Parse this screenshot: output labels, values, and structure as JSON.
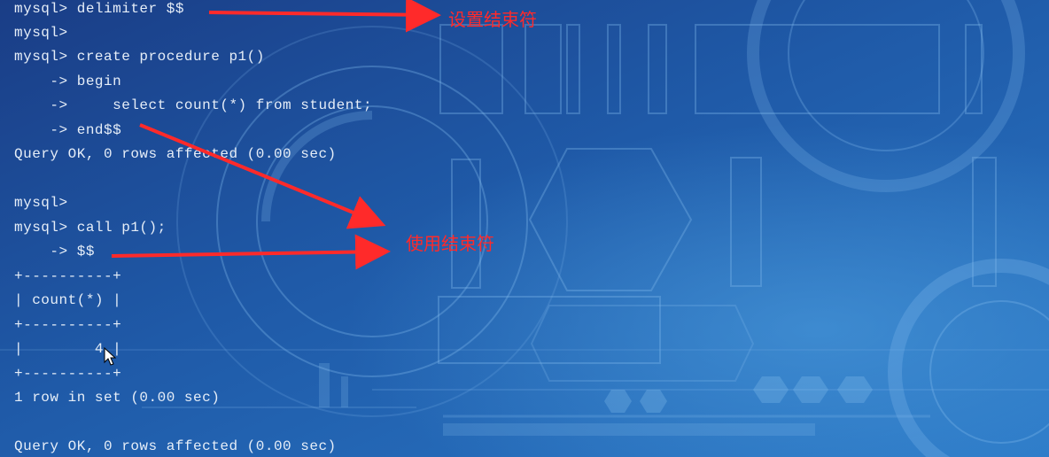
{
  "terminal": {
    "lines": [
      "mysql> delimiter $$",
      "mysql>",
      "mysql> create procedure p1()",
      "    -> begin",
      "    ->     select count(*) from student;",
      "    -> end$$",
      "Query OK, 0 rows affected (0.00 sec)",
      "",
      "mysql>",
      "mysql> call p1();",
      "    -> $$",
      "+----------+",
      "| count(*) |",
      "+----------+",
      "|        4 |",
      "+----------+",
      "1 row in set (0.00 sec)",
      "",
      "Query OK, 0 rows affected (0.00 sec)"
    ]
  },
  "annotations": {
    "set_delimiter": "设置结束符",
    "use_delimiter": "使用结束符"
  },
  "colors": {
    "background": "#1d4f96",
    "terminal_text": "#e6eef8",
    "annotation": "#ff2a2a"
  },
  "icons": {
    "cursor": "mouse-pointer-icon"
  }
}
